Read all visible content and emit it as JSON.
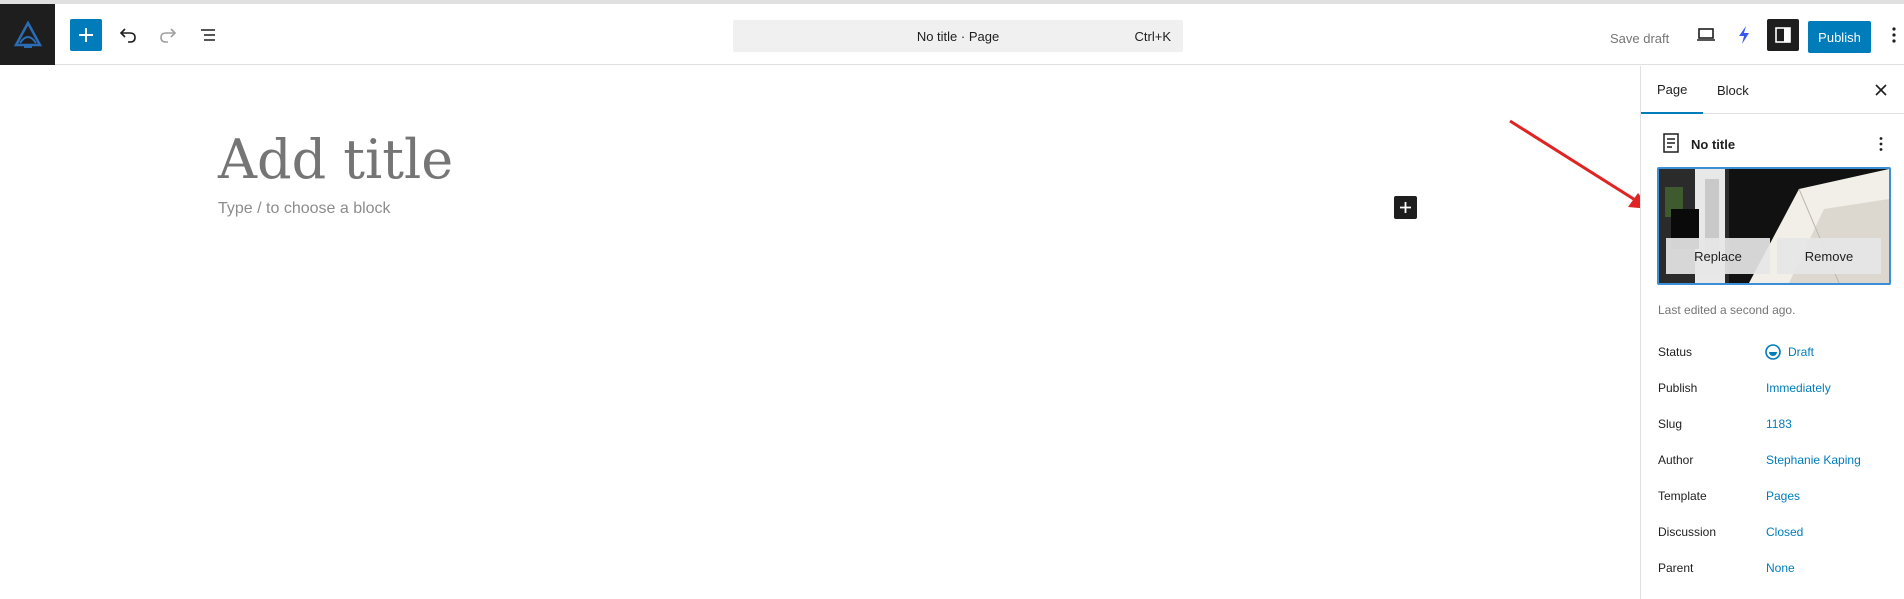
{
  "header": {
    "command_title": "No title · Page",
    "command_shortcut": "Ctrl+K",
    "save_draft": "Save draft",
    "publish": "Publish"
  },
  "icons": {
    "logo": "site-logo-icon",
    "add": "plus-icon",
    "undo": "undo-icon",
    "redo": "redo-icon",
    "list_view": "list-view-icon",
    "preview": "desktop-preview-icon",
    "bolt": "lightning-bolt-icon",
    "settings": "sidebar-toggle-icon",
    "more": "more-vertical-icon"
  },
  "canvas": {
    "title_placeholder": "Add title",
    "block_placeholder": "Type / to choose a block"
  },
  "sidebar": {
    "tabs": [
      {
        "label": "Page",
        "active": true
      },
      {
        "label": "Block",
        "active": false
      }
    ],
    "post_title": "No title",
    "featured_image": {
      "replace": "Replace",
      "remove": "Remove"
    },
    "last_edited": "Last edited a second ago.",
    "meta": [
      {
        "label": "Status",
        "value": "Draft"
      },
      {
        "label": "Publish",
        "value": "Immediately"
      },
      {
        "label": "Slug",
        "value": "1183"
      },
      {
        "label": "Author",
        "value": "Stephanie Kaping"
      },
      {
        "label": "Template",
        "value": "Pages"
      },
      {
        "label": "Discussion",
        "value": "Closed"
      },
      {
        "label": "Parent",
        "value": "None"
      }
    ]
  },
  "colors": {
    "accent": "#007cba",
    "annotation_arrow": "#e02424",
    "dark": "#1e1e1e"
  }
}
